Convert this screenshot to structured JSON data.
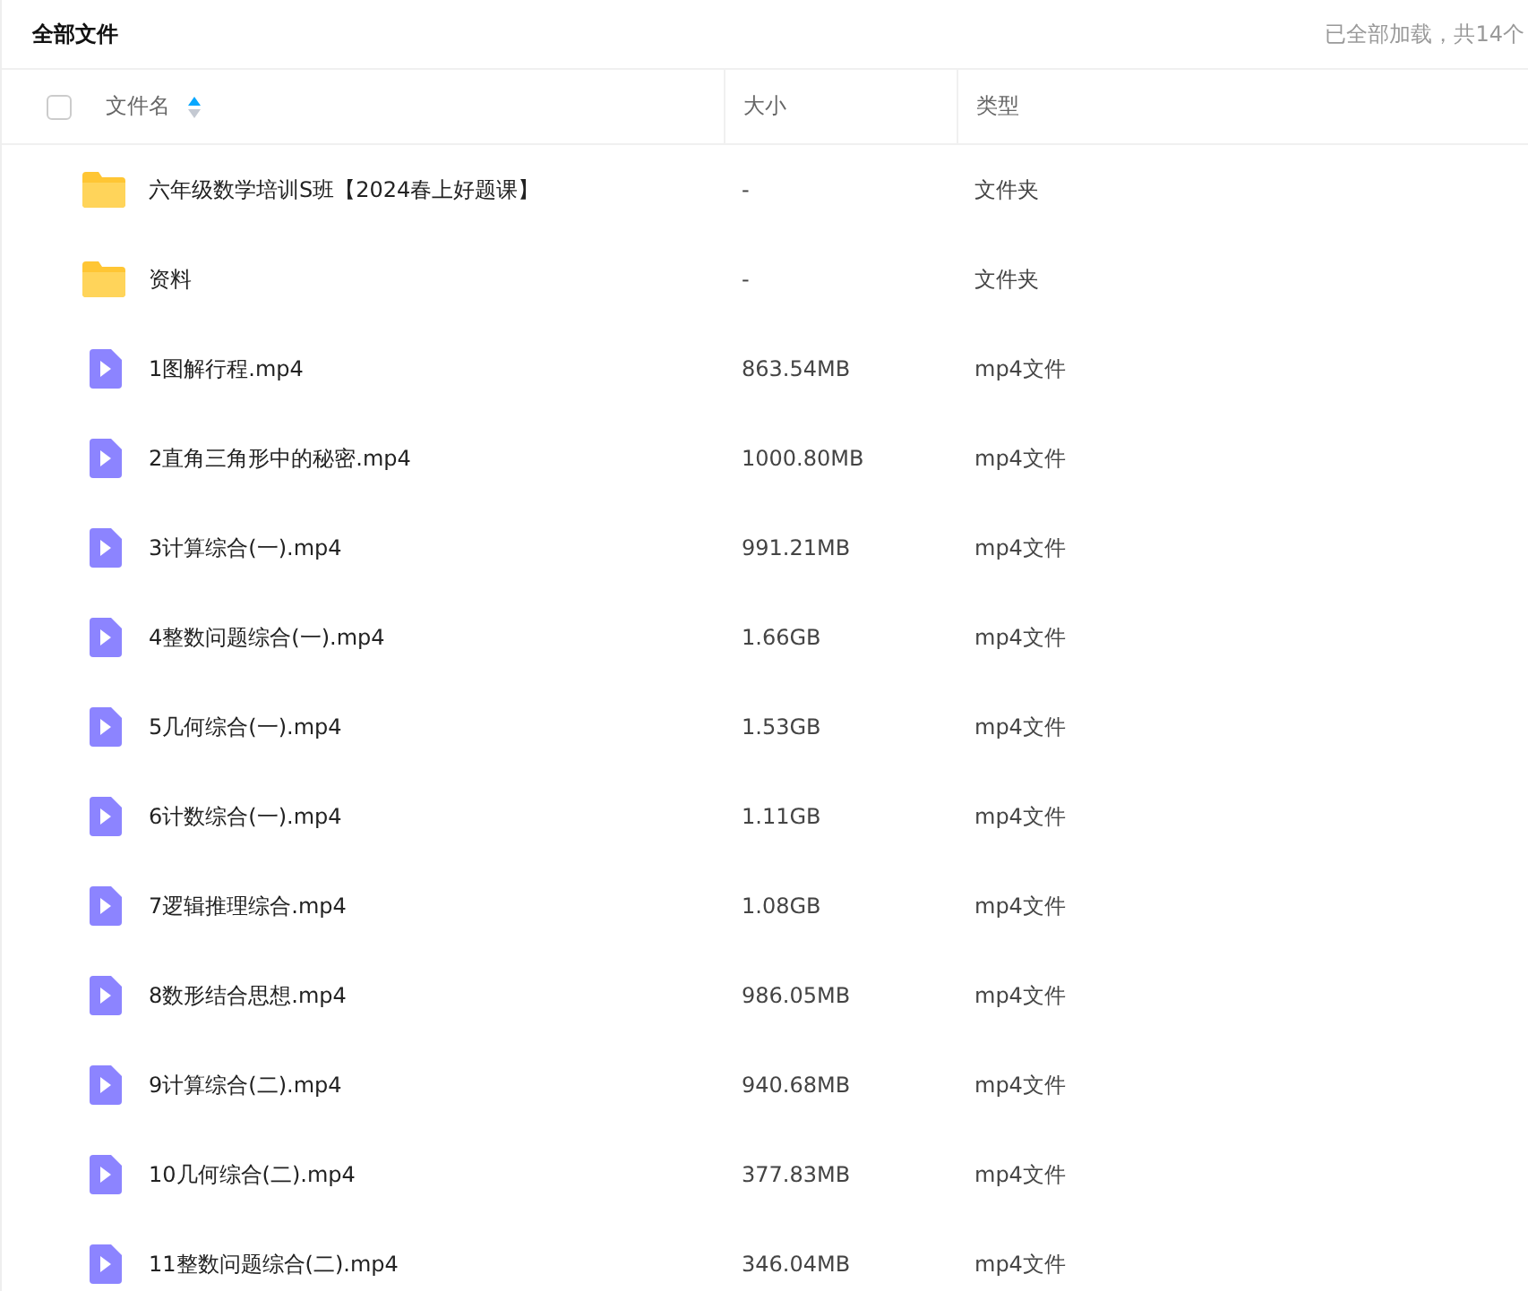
{
  "header": {
    "title": "全部文件",
    "status": "已全部加载，共14个"
  },
  "table": {
    "select_all": {
      "checked": false
    },
    "columns": [
      {
        "label": "文件名",
        "sorted": true
      },
      {
        "label": "大小"
      },
      {
        "label": "类型"
      }
    ],
    "rows": [
      {
        "kind": "folder",
        "name": "六年级数学培训S班【2024春上好题课】",
        "size": "-",
        "type": "文件夹"
      },
      {
        "kind": "folder",
        "name": "资料",
        "size": "-",
        "type": "文件夹"
      },
      {
        "kind": "video",
        "name": "1图解行程.mp4",
        "size": "863.54MB",
        "type": "mp4文件"
      },
      {
        "kind": "video",
        "name": "2直角三角形中的秘密.mp4",
        "size": "1000.80MB",
        "type": "mp4文件"
      },
      {
        "kind": "video",
        "name": "3计算综合(一).mp4",
        "size": "991.21MB",
        "type": "mp4文件"
      },
      {
        "kind": "video",
        "name": "4整数问题综合(一).mp4",
        "size": "1.66GB",
        "type": "mp4文件"
      },
      {
        "kind": "video",
        "name": "5几何综合(一).mp4",
        "size": "1.53GB",
        "type": "mp4文件"
      },
      {
        "kind": "video",
        "name": "6计数综合(一).mp4",
        "size": "1.11GB",
        "type": "mp4文件"
      },
      {
        "kind": "video",
        "name": "7逻辑推理综合.mp4",
        "size": "1.08GB",
        "type": "mp4文件"
      },
      {
        "kind": "video",
        "name": "8数形结合思想.mp4",
        "size": "986.05MB",
        "type": "mp4文件"
      },
      {
        "kind": "video",
        "name": "9计算综合(二).mp4",
        "size": "940.68MB",
        "type": "mp4文件"
      },
      {
        "kind": "video",
        "name": "10几何综合(二).mp4",
        "size": "377.83MB",
        "type": "mp4文件"
      },
      {
        "kind": "video",
        "name": "11整数问题综合(二).mp4",
        "size": "346.04MB",
        "type": "mp4文件"
      }
    ]
  }
}
